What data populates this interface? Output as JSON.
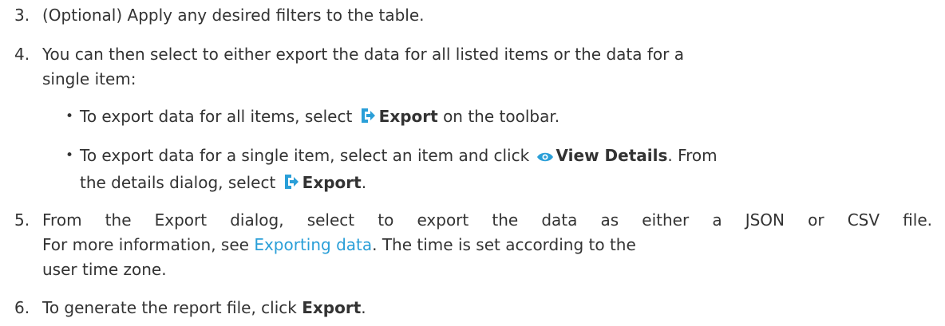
{
  "steps": [
    {
      "number": "3.",
      "text": "(Optional) Apply any desired filters to the table."
    },
    {
      "number": "4.",
      "line1": "You can then select to either export the data for all listed items or the data for a",
      "line2": "single item:",
      "bullets": [
        {
          "pre": "To export data for all items, select",
          "icon": "export-icon",
          "bold": "Export",
          "post": "on the toolbar."
        },
        {
          "pre": "To export data for a single item, select an item and click",
          "icon": "eye-icon",
          "bold": "View Details",
          "post": ". From",
          "line2_pre": "the details dialog, select",
          "line2_icon": "export-icon",
          "line2_bold": "Export",
          "line2_post": "."
        }
      ]
    },
    {
      "number": "5.",
      "line1": "From the Export dialog, select to export the data as either a JSON or CSV file.",
      "line2_pre": "For more information, see",
      "line2_link": "Exporting data",
      "line2_post": ". The time is set according to the",
      "line3": "user time zone."
    },
    {
      "number": "6.",
      "pre": "To generate the report file, click",
      "bold": "Export",
      "post": "."
    }
  ],
  "colors": {
    "text": "#333333",
    "link": "#2a9fd8",
    "icon_blue": "#2a9fd8"
  }
}
